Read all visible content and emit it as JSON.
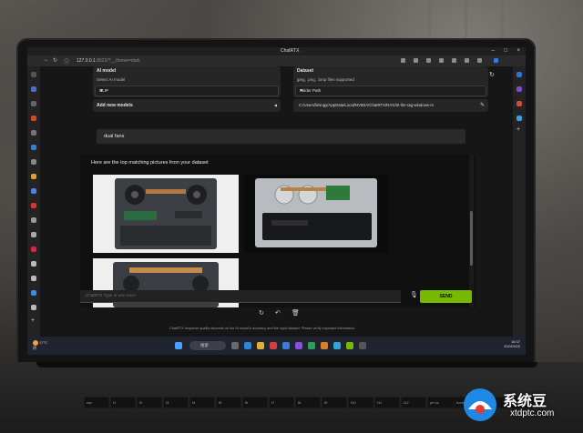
{
  "window": {
    "title": "ChatRTX"
  },
  "browser": {
    "url_host": "127.0.0.1",
    "url_rest": ":8622/?__theme=dark"
  },
  "ai_model": {
    "label": "AI model",
    "sublabel": "Select AI model",
    "selected": "CLIP",
    "add_models": "Add new models"
  },
  "dataset": {
    "label": "Dataset",
    "sublabel": "jpeg, .png, .bmp files supported",
    "source": "Folder Path",
    "path": "C:/Users/limingy/AppData/Local/NVIDIA/ChatRTX/RAG/trt-llm-rag-windows-m"
  },
  "chat": {
    "query": "dual fans",
    "result_title": "Here are the top matching pictures from your dataset",
    "input_placeholder": "ChatRTX Type or use voice",
    "send_label": "SEND",
    "disclaimer": "ChatRTX response quality depends on the AI model's accuracy and the input dataset. Please verify important information."
  },
  "taskbar": {
    "weather_temp": "17°C",
    "weather_desc": "阴",
    "search_label": "搜索",
    "time": "16:37",
    "date": "2024/3/20"
  },
  "keyboard": {
    "keys": [
      "esc",
      "f1",
      "f2",
      "f3",
      "f4",
      "f5",
      "f6",
      "f7",
      "f8",
      "f9",
      "f10",
      "f11",
      "f12",
      "prt sc",
      "home",
      "end",
      "delete"
    ]
  },
  "watermark": {
    "name": "系统豆",
    "url": "xtdptc.com"
  }
}
